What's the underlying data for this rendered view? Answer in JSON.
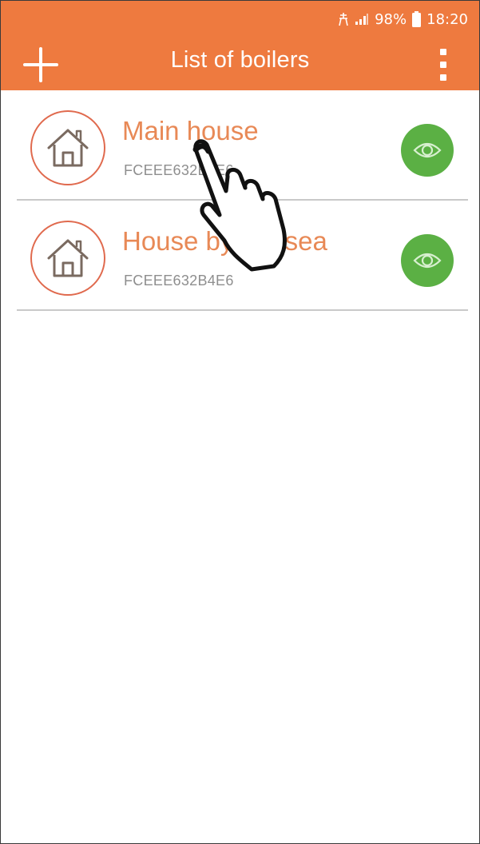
{
  "status_bar": {
    "battery_percent": "98%",
    "time": "18:20",
    "icons": [
      "alarm-icon",
      "signal-icon",
      "battery-icon"
    ]
  },
  "app_bar": {
    "title": "List of boilers",
    "add_icon": "plus-icon",
    "menu_icon": "more-vertical-icon",
    "background_color": "#ee7a3f"
  },
  "boilers": [
    {
      "name": "Main house",
      "id": "FCEEE632B4E6",
      "icon": "house-icon",
      "view_icon": "eye-icon"
    },
    {
      "name": "House by the sea",
      "id": "FCEEE632B4E6",
      "icon": "house-icon",
      "view_icon": "eye-icon"
    }
  ],
  "colors": {
    "accent": "#ee7a3f",
    "item_name": "#e88956",
    "item_id": "#8e8e8e",
    "view_button": "#5bb044"
  },
  "overlay": {
    "icon": "hand-pointer-icon"
  }
}
